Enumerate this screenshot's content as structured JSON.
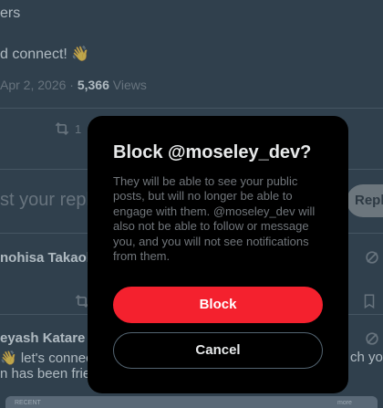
{
  "background": {
    "line1": "ers",
    "line2": "d connect! 👋",
    "meta": {
      "date": "Apr 2, 2026",
      "separator": "·",
      "views_count": "5,366",
      "views_label": "Views"
    },
    "actions": {
      "retweet_count": "1"
    },
    "reply_box": {
      "placeholder": "st your reply",
      "reply_button": "Reply"
    },
    "reply1": {
      "name": "nohisa Takaoka"
    },
    "reply2": {
      "name": "eyash Katare",
      "line1": "👋 let's connect.",
      "line2": "n has been fried",
      "right_text": "ch your"
    },
    "bottom_bar": {
      "left": "RECENT",
      "right": "more"
    }
  },
  "modal": {
    "title": "Block @moseley_dev?",
    "body": "They will be able to see your public posts, but will no longer be able to engage with them. @moseley_dev will also not be able to follow or message you, and you will not see notifications from them.",
    "block_button": "Block",
    "cancel_button": "Cancel"
  },
  "colors": {
    "modal_bg": "#000000",
    "block_red": "#f4212e",
    "muted_text": "#71767b",
    "verified_blue": "#1d9bf0"
  }
}
